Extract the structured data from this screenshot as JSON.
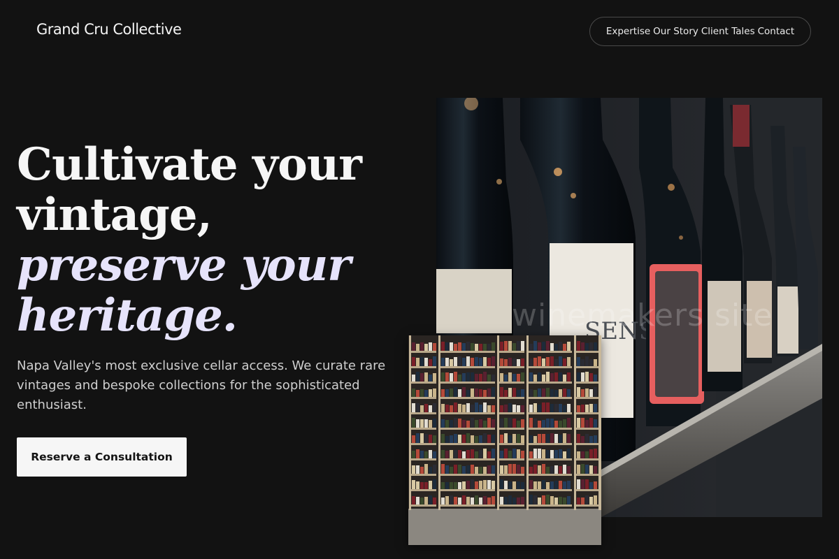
{
  "brand": {
    "name": "Grand Cru Collective"
  },
  "nav": {
    "items": [
      "Expertise",
      "Our Story",
      "Client Tales",
      "Contact"
    ]
  },
  "hero": {
    "line1": "Cultivate your",
    "line2": "vintage,",
    "line3": "preserve your",
    "line4": "heritage.",
    "subtitle": "Napa Valley's most exclusive cellar access. We curate rare vintages and bespoke collections for the sophisticated enthusiast.",
    "cta_label": "Reserve a Consultation"
  },
  "images": {
    "bottles": {
      "label_text": "SENS",
      "watermark": "winemakers site"
    },
    "shelves": {}
  },
  "colors": {
    "background": "#121212",
    "text": "#f2f2f2",
    "accent_italic": "#e6e3fb",
    "button_bg": "#f6f6f6",
    "button_text": "#141414"
  }
}
